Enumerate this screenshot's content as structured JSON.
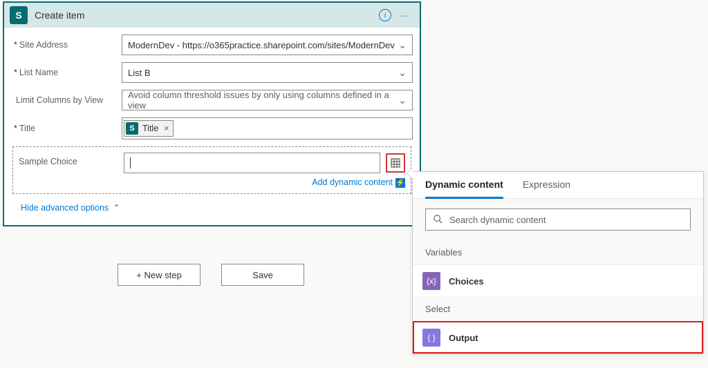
{
  "card": {
    "logo": "S",
    "title": "Create item"
  },
  "form": {
    "siteAddress": {
      "label": "Site Address",
      "value": "ModernDev - https://o365practice.sharepoint.com/sites/ModernDev"
    },
    "listName": {
      "label": "List Name",
      "value": "List B"
    },
    "limitColumns": {
      "label": "Limit Columns by View",
      "placeholder": "Avoid column threshold issues by only using columns defined in a view"
    },
    "titleField": {
      "label": "Title",
      "tokenLabel": "Title",
      "tokenLogo": "S"
    },
    "sampleChoice": {
      "label": "Sample Choice"
    },
    "addDynamic": "Add dynamic content",
    "hideAdvanced": "Hide advanced options"
  },
  "footer": {
    "newStep": "+ New step",
    "save": "Save"
  },
  "flyout": {
    "tabs": {
      "dynamic": "Dynamic content",
      "expression": "Expression"
    },
    "searchPlaceholder": "Search dynamic content",
    "groups": {
      "variables": "Variables",
      "select": "Select"
    },
    "items": {
      "choices": "Choices",
      "output": "Output"
    }
  }
}
